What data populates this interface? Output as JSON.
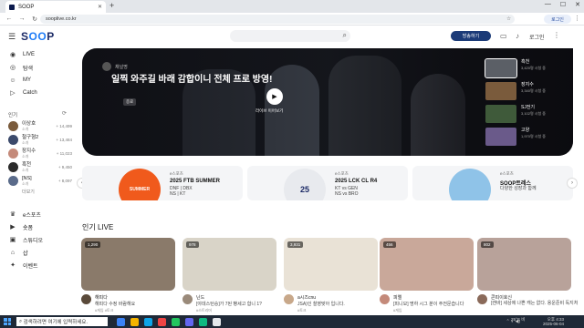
{
  "browser": {
    "tab_title": "SOOP",
    "url": "sooplive.co.kr",
    "login_chip": "로그인"
  },
  "header": {
    "logo": "SOOP",
    "golive_label": "방송하기",
    "login_label": "로그인"
  },
  "sidebar": {
    "main_items": [
      {
        "label": "LIVE",
        "icon": "broadcast-icon"
      },
      {
        "label": "탐색",
        "icon": "compass-icon"
      },
      {
        "label": "MY",
        "icon": "user-icon"
      },
      {
        "label": "Catch",
        "icon": "catch-icon"
      }
    ],
    "section_label": "인기",
    "streamers": [
      {
        "name": "이상호",
        "sub": "소개",
        "count": "+ 14,499",
        "color": "#7a5b3c"
      },
      {
        "name": "철구형2",
        "sub": "소개",
        "count": "+ 13,484",
        "color": "#3b4a6b"
      },
      {
        "name": "장지수",
        "sub": "소개",
        "count": "+ 11,023",
        "color": "#c48a7a"
      },
      {
        "name": "흑천",
        "sub": "소개",
        "count": "+ 9,450",
        "color": "#2b2b2b"
      },
      {
        "name": "[NS]",
        "sub": "소개",
        "count": "+ 8,097",
        "color": "#5a6b8a"
      }
    ],
    "more_label": "더보기",
    "bottom_items": [
      {
        "label": "e스포츠",
        "icon": "trophy-icon"
      },
      {
        "label": "숏폼",
        "icon": "shorts-icon"
      },
      {
        "label": "스튜디오",
        "icon": "studio-icon"
      },
      {
        "label": "샵",
        "icon": "shop-icon"
      },
      {
        "label": "이벤트",
        "icon": "gift-icon"
      }
    ]
  },
  "hero": {
    "channel": "채널명",
    "title": "일찍 와주길 바래 감합이니 전체 프로 방영!",
    "tag": "종료",
    "play_label": "라이브 이어보기",
    "playlist": [
      {
        "title": "흑천",
        "meta": "3,420명 시청 중",
        "color": "#5b5f66"
      },
      {
        "title": "장지수",
        "meta": "3,340명 시청 중",
        "color": "#7a5b3c"
      },
      {
        "title": "SJ전기",
        "meta": "3,102명 시청 중",
        "color": "#3f5a3a"
      },
      {
        "title": "고양",
        "meta": "1,970명 시청 중",
        "color": "#6a5a8a"
      }
    ]
  },
  "channel_cards": [
    {
      "meta": "e스포츠",
      "name": "2025 FTB SUMMER",
      "desc": "DNF | DBX\nNS | KT",
      "art_color": "#f05a1c",
      "art_text": "SUMMER"
    },
    {
      "meta": "e스포츠",
      "name": "2025 LCK CL R4",
      "desc": "KT vs GEN\nNS vs BRO",
      "art_color": "#e8eaee",
      "art_text": "25"
    },
    {
      "meta": "e스포츠",
      "name": "SOOP트레스",
      "desc": "다양한 성장과 함께",
      "art_color": "#8fc3e8",
      "art_text": ""
    }
  ],
  "popular": {
    "title": "인기 LIVE",
    "cards": [
      {
        "viewers": "1,290",
        "name": "해피다",
        "title": "해피다 수정 바람해요",
        "tags": "#게임 #토크",
        "thumb": "#8a7a6a",
        "av": "#5a4a3a"
      },
      {
        "viewers": "978",
        "name": "닌드",
        "title": "[야데스턴승]가 7된 빵세고 합니 1?",
        "tags": "#스트리머",
        "thumb": "#d9d4c8",
        "av": "#9a8a7a"
      },
      {
        "viewers": "3,931",
        "name": "a시즈cnu",
        "title": "JSA)인 찰영맞아 입니다.",
        "tags": "#토크",
        "thumb": "#e9e2d6",
        "av": "#c8a88a"
      },
      {
        "viewers": "456",
        "name": "피엘",
        "title": "[피니모] 명하 시그 분이 주전문습니다",
        "tags": "#게임",
        "thumb": "#c9a89a",
        "av": "#c48a7a"
      },
      {
        "viewers": "802",
        "name": "콘피이호신",
        "title": "[캔바] 세상에 나쁜 캐는 없다. 용운준비 독지처",
        "tags": "#일상",
        "thumb": "#b8a29a",
        "av": "#8a6a5a"
      }
    ]
  },
  "taskbar": {
    "search_placeholder": "검색하려면 여기에 입력하세요.",
    "weather": "25°C 비",
    "time": "오후 4:33",
    "date": "2025-06-04"
  }
}
